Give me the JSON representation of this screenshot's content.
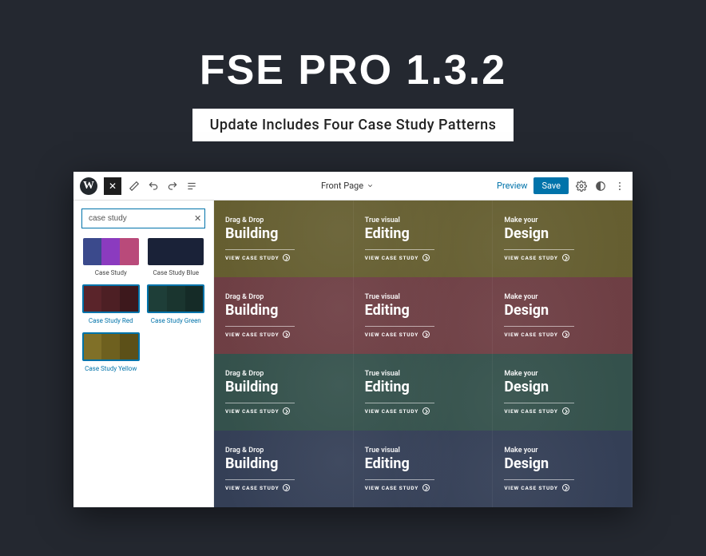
{
  "hero": {
    "title": "FSE PRO 1.3.2",
    "subtitle": "Update Includes Four Case Study Patterns"
  },
  "topbar": {
    "page_title": "Front Page",
    "preview_label": "Preview",
    "save_label": "Save"
  },
  "sidebar": {
    "search_value": "case study",
    "patterns": [
      {
        "label": "Case Study"
      },
      {
        "label": "Case Study Blue"
      },
      {
        "label": "Case Study Red"
      },
      {
        "label": "Case Study Green"
      },
      {
        "label": "Case Study Yellow"
      }
    ]
  },
  "canvas": {
    "columns": [
      {
        "eyebrow": "Drag & Drop",
        "title": "Building",
        "cta": "VIEW CASE STUDY"
      },
      {
        "eyebrow": "True visual",
        "title": "Editing",
        "cta": "VIEW CASE STUDY"
      },
      {
        "eyebrow": "Make your",
        "title": "Design",
        "cta": "VIEW CASE STUDY"
      }
    ],
    "rows": 4
  }
}
